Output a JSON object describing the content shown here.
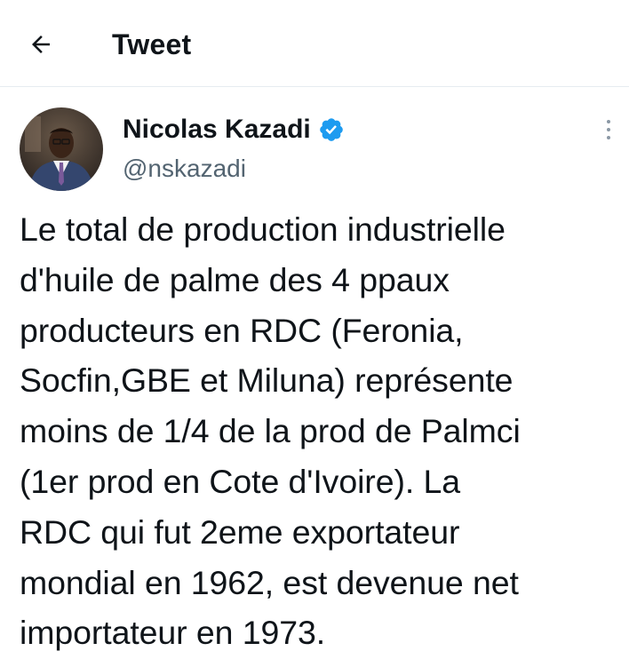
{
  "header": {
    "back_icon": "arrow-left-icon",
    "title": "Tweet"
  },
  "tweet": {
    "author": {
      "name": "Nicolas Kazadi",
      "handle": "@nskazadi",
      "verified_icon": "verified-badge-icon",
      "verified_color": "#1d9bf0"
    },
    "more_icon": "more-vertical-icon",
    "text": "Le total de production industrielle\nd'huile de palme des 4 ppaux\nproducteurs en RDC (Feronia,\nSocfin,GBE et Miluna) représente\nmoins de 1/4 de la prod de Palmci\n(1er prod en Cote d'Ivoire). La\nRDC qui fut 2eme exportateur\nmondial en 1962, est devenue net\nimportateur en 1973."
  },
  "colors": {
    "text_primary": "#0f1419",
    "text_secondary": "#536471",
    "divider": "#e6ecf0",
    "verified": "#1d9bf0"
  }
}
